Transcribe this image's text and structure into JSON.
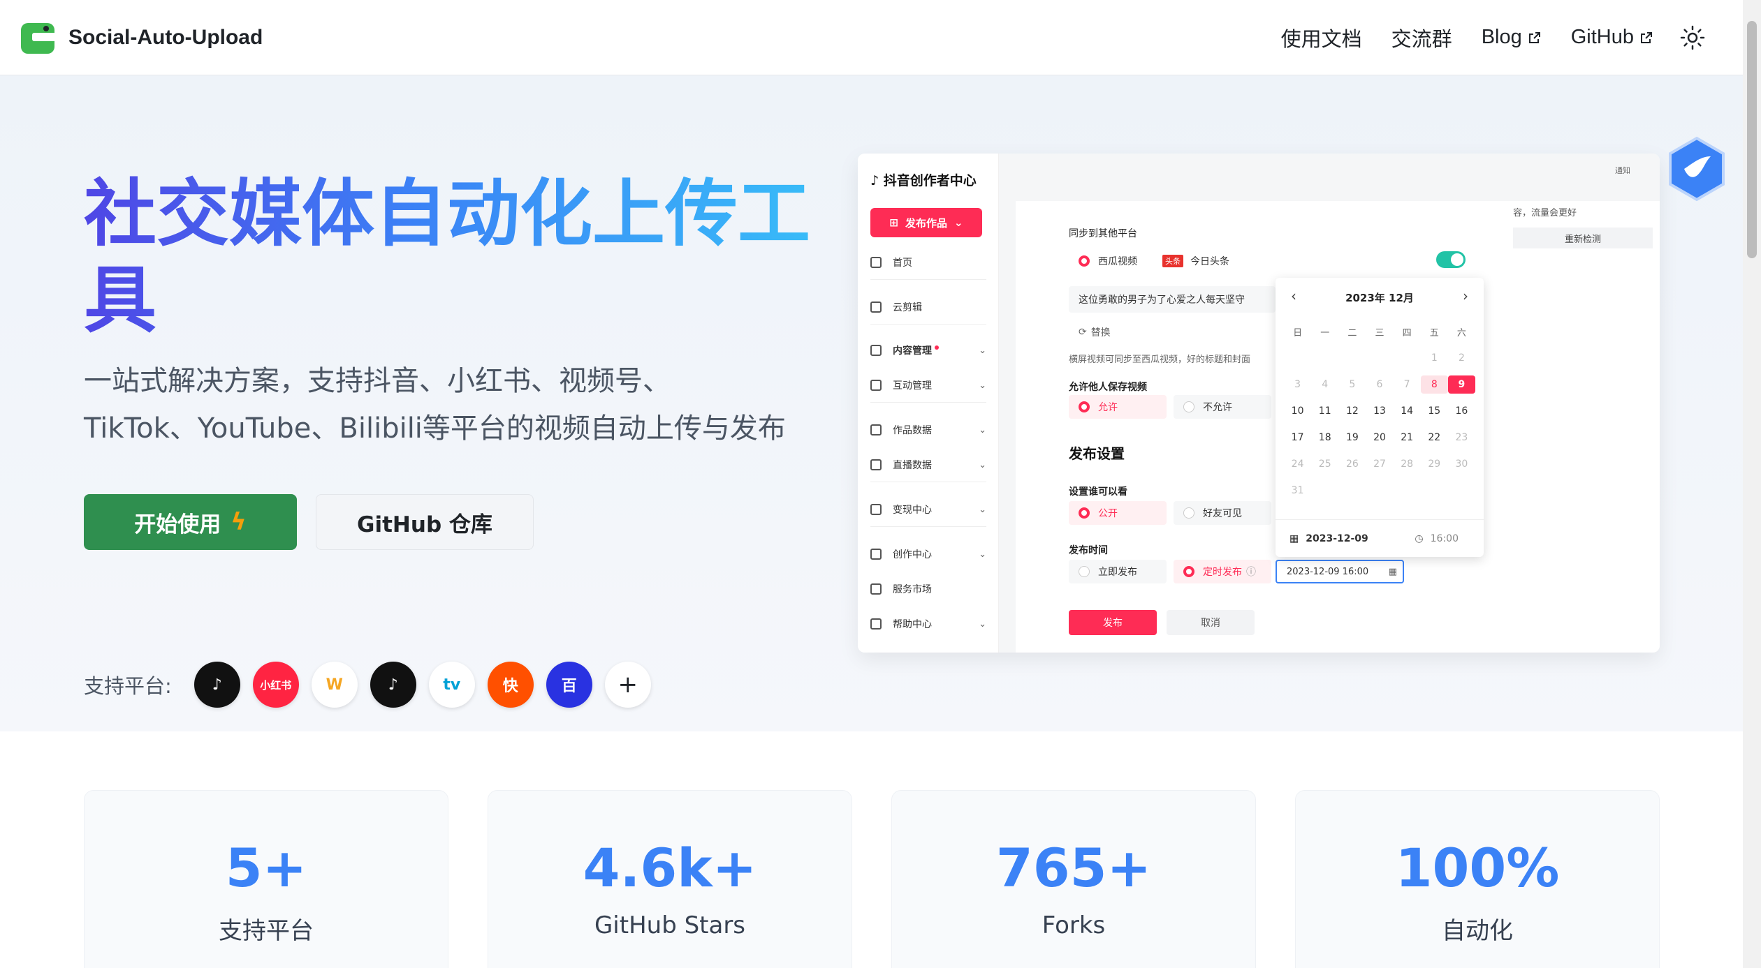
{
  "nav": {
    "brand": "Social-Auto-Upload",
    "links": [
      "使用文档",
      "交流群",
      "Blog",
      "GitHub"
    ]
  },
  "hero": {
    "title": "社交媒体自动化上传工具",
    "subtitle_line1": "一站式解决方案，支持抖音、小红书、视频号、",
    "subtitle_line2": "TikTok、YouTube、Bilibili等平台的视频自动上传与发布",
    "primary_button": "开始使用",
    "secondary_button": "GitHub 仓库",
    "platforms_label": "支持平台:",
    "platform_icons": [
      {
        "name": "douyin",
        "bg": "#111111",
        "label": "♪"
      },
      {
        "name": "xiaohongshu",
        "bg": "#ff2442",
        "label": "小红书"
      },
      {
        "name": "shipinhao",
        "bg": "#ffffff",
        "label": "W"
      },
      {
        "name": "tiktok",
        "bg": "#111111",
        "label": "♪"
      },
      {
        "name": "bilibili",
        "bg": "#ffffff",
        "label": "tv"
      },
      {
        "name": "kuaishou",
        "bg": "#ff5000",
        "label": "快"
      },
      {
        "name": "baijiahao",
        "bg": "#2932e1",
        "label": "百"
      }
    ],
    "more": "+"
  },
  "mock": {
    "app_title": "抖音创作者中心",
    "publish_btn": "发布作品",
    "sidebar": [
      "首页",
      "云剪辑",
      "内容管理",
      "互动管理",
      "作品数据",
      "直播数据",
      "变现中心",
      "创作中心",
      "服务市场",
      "帮助中心"
    ],
    "sync_label": "同步到其他平台",
    "xigua": "西瓜视频",
    "toutiao": "今日头条",
    "toutiao_badge": "头条",
    "caption": "这位勇敢的男子为了心爱之人每天坚守",
    "replace": "替换",
    "hint": "横屏视频可同步至西瓜视频，好的标题和封面",
    "allow_save_label": "允许他人保存视频",
    "allow": "允许",
    "disallow": "不允许",
    "publish_settings": "发布设置",
    "visible_label": "设置谁可以看",
    "public": "公开",
    "friends": "好友可见",
    "time_label": "发布时间",
    "now": "立即发布",
    "scheduled": "定时发布",
    "datetime_value": "2023-12-09 16:00",
    "submit": "发布",
    "cancel": "取消",
    "right_text": "容，流量会更好",
    "recheck": "重新检测",
    "notify": "通知",
    "calendar": {
      "header": "2023年 12月",
      "weekdays": [
        "日",
        "一",
        "二",
        "三",
        "四",
        "五",
        "六"
      ],
      "foot_date": "2023-12-09",
      "foot_time": "16:00"
    }
  },
  "stats": [
    {
      "value": "5+",
      "label": "支持平台"
    },
    {
      "value": "4.6k+",
      "label": "GitHub Stars"
    },
    {
      "value": "765+",
      "label": "Forks"
    },
    {
      "value": "100%",
      "label": "自动化"
    }
  ]
}
